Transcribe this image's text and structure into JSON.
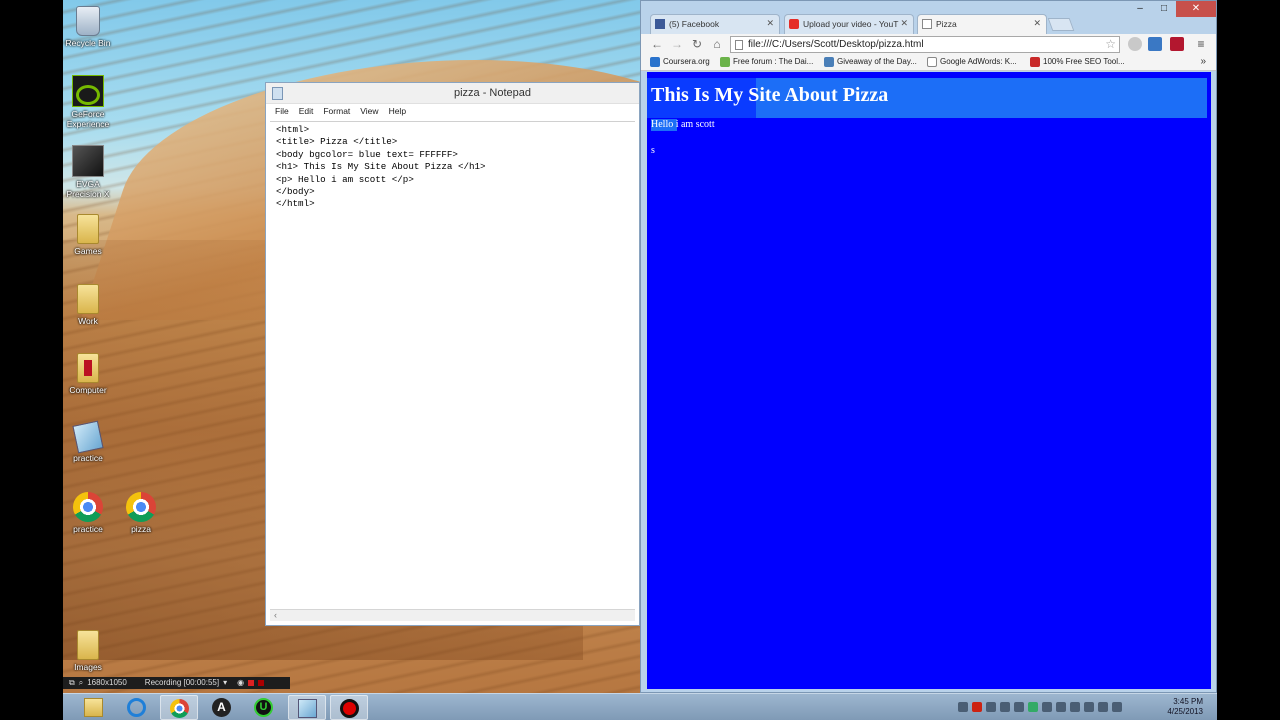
{
  "desktop": {
    "icons": [
      {
        "label": "Recycle Bin",
        "icon": "recycle-bin-icon"
      },
      {
        "label": "GeForce Experience",
        "icon": "geforce-icon"
      },
      {
        "label": "EVGA Precision X",
        "icon": "evga-icon"
      },
      {
        "label": "Games",
        "icon": "folder-icon"
      },
      {
        "label": "Work",
        "icon": "folder-icon"
      },
      {
        "label": "Computer",
        "icon": "folder-icon"
      },
      {
        "label": "practice",
        "icon": "notepad-file-icon"
      },
      {
        "label": "practice",
        "icon": "chrome-icon"
      },
      {
        "label": "pizza",
        "icon": "chrome-icon"
      },
      {
        "label": "Images",
        "icon": "folder-icon"
      }
    ]
  },
  "notepad": {
    "title": "pizza - Notepad",
    "menu": [
      "File",
      "Edit",
      "Format",
      "View",
      "Help"
    ],
    "content": "<html>\n<title> Pizza </title>\n<body bgcolor= blue text= FFFFFF>\n<h1> This Is My Site About Pizza </h1>\n<p> Hello i am scott </p>\n</body>\n</html>"
  },
  "browser": {
    "tabs": [
      {
        "label": "(5) Facebook",
        "icon": "facebook-icon"
      },
      {
        "label": "Upload your video - YouT",
        "icon": "youtube-icon"
      },
      {
        "label": "Pizza",
        "icon": "page-icon"
      }
    ],
    "url": "file:///C:/Users/Scott/Desktop/pizza.html",
    "bookmarks": [
      "Coursera.org",
      "Free forum : The Dai...",
      "Giveaway of the Day...",
      "Google AdWords: K...",
      "100% Free SEO Tool..."
    ],
    "bookmarks_more": "»",
    "page": {
      "heading": "This Is My Site About Pizza",
      "paragraph": "Hello i am scott",
      "stray": "s",
      "bg_color": "#0000ff",
      "text_color": "#ffffff"
    }
  },
  "recorder": {
    "resolution": "1680x1050",
    "status": "Recording [00:00:55]"
  },
  "clock": {
    "time": "3:45 PM",
    "date": "4/25/2013"
  }
}
